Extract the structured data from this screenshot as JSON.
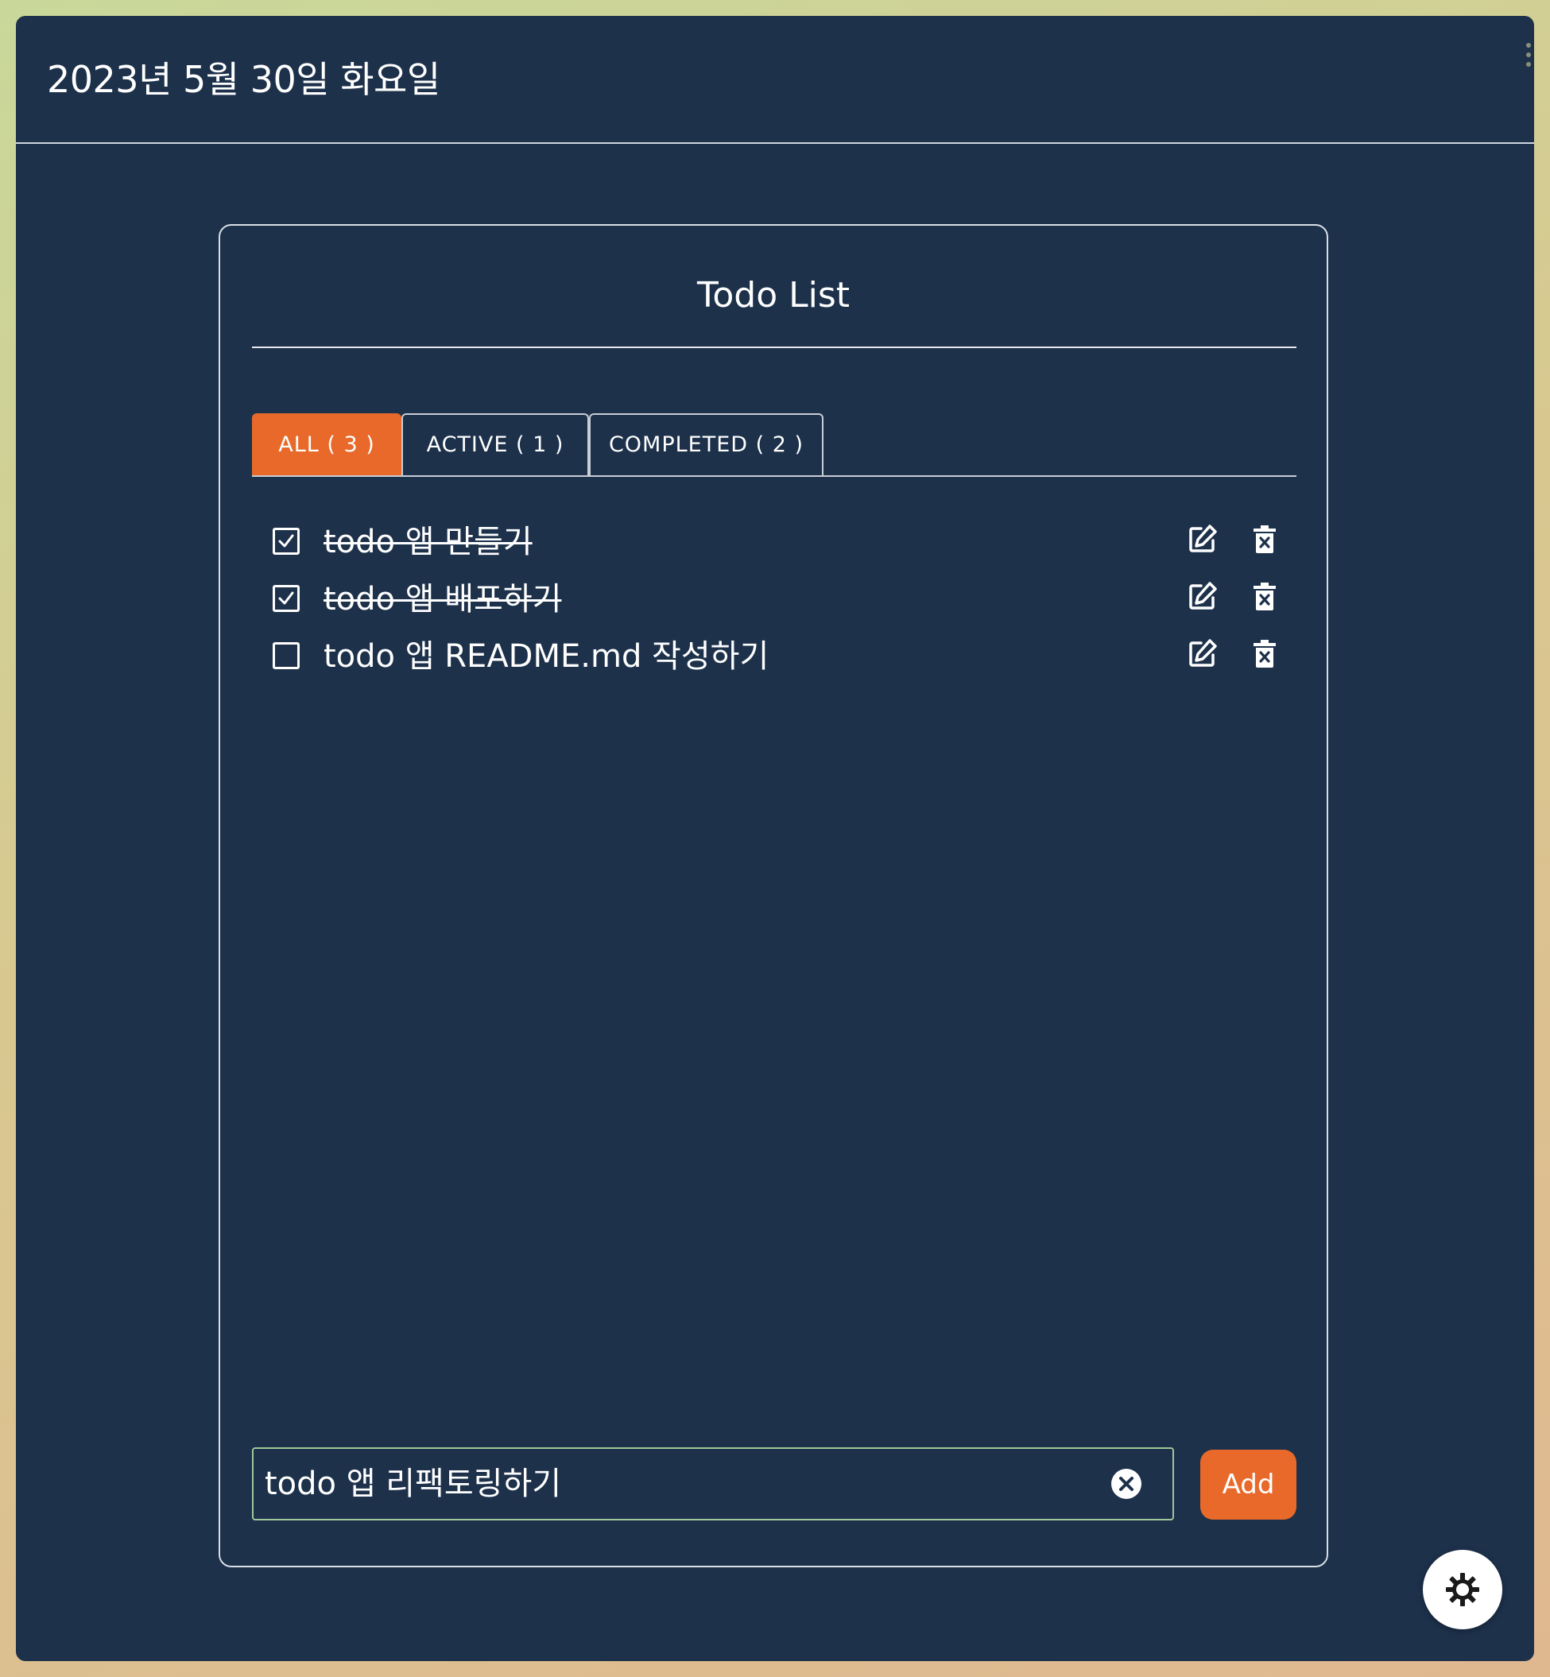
{
  "header": {
    "date": "2023년 5월 30일 화요일"
  },
  "card": {
    "title": "Todo List"
  },
  "tabs": [
    {
      "label": "ALL ( 3 )",
      "selected": true
    },
    {
      "label": "ACTIVE ( 1 )",
      "selected": false
    },
    {
      "label": "COMPLETED ( 2 )",
      "selected": false
    }
  ],
  "todos": [
    {
      "text": "todo 앱 만들기",
      "completed": true,
      "edit_icon": "edit-icon",
      "delete_icon": "trash-icon"
    },
    {
      "text": "todo 앱 배포하기",
      "completed": true,
      "edit_icon": "edit-icon",
      "delete_icon": "trash-icon"
    },
    {
      "text": "todo 앱 README.md 작성하기",
      "completed": false,
      "edit_icon": "edit-icon",
      "delete_icon": "trash-icon"
    }
  ],
  "add_form": {
    "input_value": "todo 앱 리팩토링하기",
    "clear_icon": "close-circle-icon",
    "add_label": "Add"
  },
  "theme_toggle": {
    "icon": "sun-icon"
  },
  "colors": {
    "background": "#1d314b",
    "accent": "#e8692a",
    "text": "#ffffff"
  }
}
